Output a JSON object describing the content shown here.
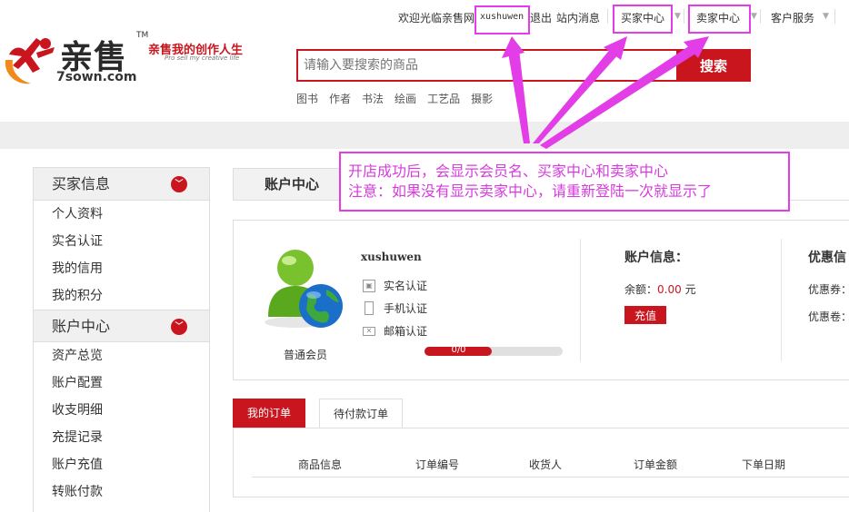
{
  "topbar": {
    "welcome": "欢迎光临亲售网",
    "username": "xushuwen",
    "logout": "退出",
    "messages": "站内消息",
    "buyer_center": "买家中心",
    "seller_center": "卖家中心",
    "customer_service": "客户服务"
  },
  "logo": {
    "name": "亲售",
    "tm": "TM",
    "domain": "7sown.com",
    "slogan": "亲售我的创作人生",
    "slogan_en": "Pro sell my creative life"
  },
  "search": {
    "placeholder": "请输入要搜索的商品",
    "button": "搜索",
    "hot_words": [
      "图书",
      "作者",
      "书法",
      "绘画",
      "工艺品",
      "摄影"
    ]
  },
  "sidebar": {
    "sections": [
      {
        "title": "买家信息",
        "items": [
          "个人资料",
          "实名认证",
          "我的信用",
          "我的积分"
        ]
      },
      {
        "title": "账户中心",
        "items": [
          "资产总览",
          "账户配置",
          "收支明细",
          "充提记录",
          "账户充值",
          "转账付款"
        ]
      }
    ]
  },
  "account": {
    "tab_title": "账户中心",
    "username": "xushuwen",
    "member_level": "普通会员",
    "verifications": [
      "实名认证",
      "手机认证",
      "邮箱认证"
    ],
    "progress_text": "0/0",
    "progress_fraction": 0.49,
    "info_title": "账户信息：",
    "balance_label": "余额：",
    "balance_value": "0.00",
    "balance_unit": "元",
    "recharge": "充值",
    "coupon_title": "优惠信",
    "coupon_row1": "优惠券：",
    "coupon_row2": "优惠卷："
  },
  "orders": {
    "tabs": [
      "我的订单",
      "待付款订单"
    ],
    "columns": [
      "商品信息",
      "订单编号",
      "收货人",
      "订单金额",
      "下单日期"
    ]
  },
  "annotation": {
    "line1": "开店成功后，会显示会员名、买家中心和卖家中心",
    "line2": "注意：如果没有显示卖家中心，请重新登陆一次就显示了",
    "color": "#e23de6"
  },
  "colors": {
    "brand_red": "#c9151e"
  }
}
